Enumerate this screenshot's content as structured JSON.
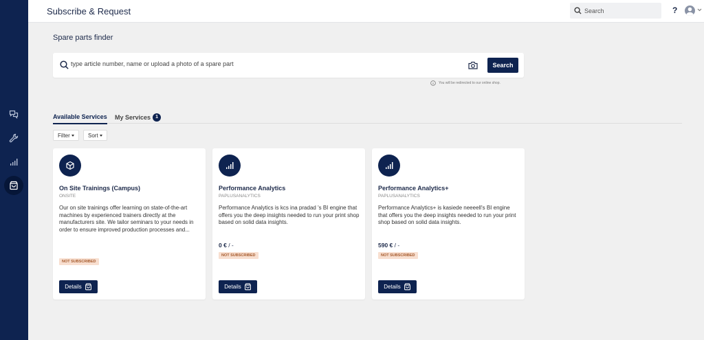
{
  "header": {
    "title": "Subscribe & Request",
    "search_placeholder": "Search",
    "help_label": "?"
  },
  "sidebar": {
    "items": [
      {
        "icon": "chat-icon"
      },
      {
        "icon": "wrench-icon"
      },
      {
        "icon": "bar-chart-icon"
      },
      {
        "icon": "shopping-bag-icon",
        "active": true
      }
    ]
  },
  "finder": {
    "title": "Spare parts finder",
    "placeholder": "type article number, name or upload a photo of a spare part",
    "search_label": "Search",
    "note": "You will be redirected to our online shop."
  },
  "tabs": {
    "available": "Available Services",
    "my": "My Services",
    "my_count": "1"
  },
  "filters": {
    "filter_label": "Filter",
    "sort_label": "Sort"
  },
  "cards": [
    {
      "icon": "cube-icon",
      "title": "On Site Trainings (Campus)",
      "subtitle": "ONSITE",
      "description": "Our on site trainings offer learning on state-of-the-art machines by experienced trainers directly at the manufacturers site. We tailor seminars to your needs in order to ensure improved production processes and...",
      "status": "NOT SUBSCRIBED",
      "details_label": "Details"
    },
    {
      "icon": "signal-icon",
      "title": "Performance Analytics",
      "subtitle": "PAPLUSANALYTICS",
      "description": "Performance Analytics is kcs ina pradad 's BI engine that offers you the deep insights needed to run your print shop based on solid data insights.",
      "price": "0 €",
      "price_suffix": " / -",
      "status": "NOT SUBSCRIBED",
      "details_label": "Details"
    },
    {
      "icon": "signal-icon",
      "title": "Performance Analytics+",
      "subtitle": "PAPLUSANALYTICS",
      "description": "Performance Analytics+ is kasiede neeeell's BI engine that offers you the deep insights needed to run your print shop based on solid data insights.",
      "price": "590 €",
      "price_suffix": " / -",
      "status": "NOT SUBSCRIBED",
      "details_label": "Details"
    }
  ],
  "colors": {
    "brand": "#0e2350",
    "background": "#f0f0f0",
    "status_bg": "#f8dfd0",
    "status_text": "#a55a2c"
  }
}
